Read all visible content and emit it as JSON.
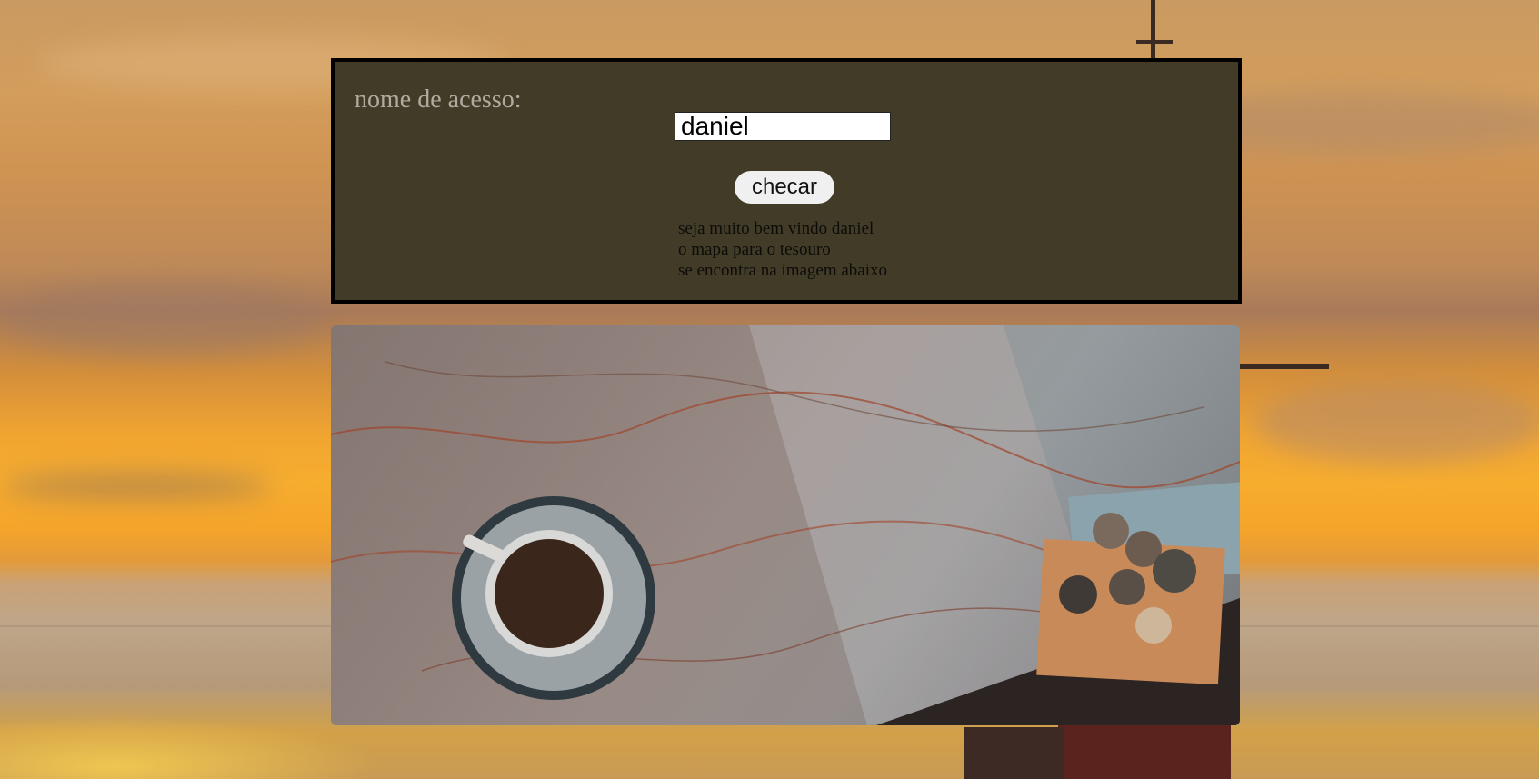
{
  "background": {
    "description_icon": "sunset-ship-background"
  },
  "login_panel": {
    "label": "nome de acesso:",
    "input_value": "daniel",
    "button_label": "checar",
    "message_lines": [
      "seja muito bem vindo daniel",
      "o mapa para o tesouro",
      "se encontra na imagem abaixo"
    ]
  },
  "map": {
    "icon": "treasure-map-image"
  },
  "colors": {
    "panel_bg": "#413b28",
    "panel_border": "#000000",
    "label_text": "#b0ab9e",
    "button_bg": "#f0f0f0"
  }
}
